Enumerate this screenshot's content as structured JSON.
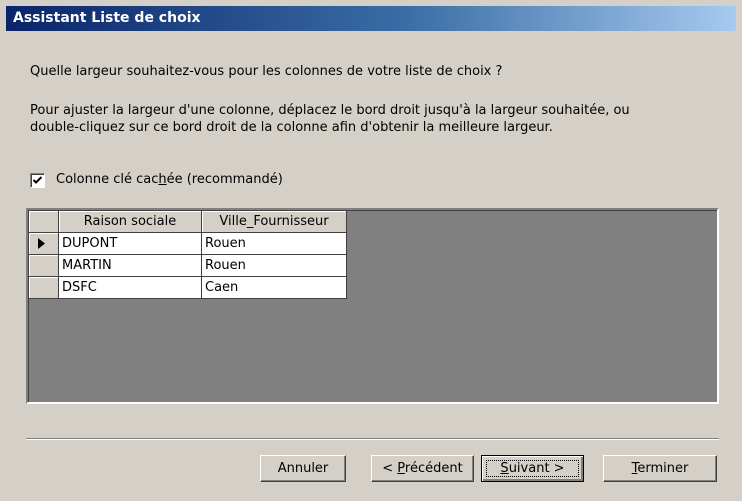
{
  "window": {
    "title": "Assistant Liste de choix"
  },
  "question": "Quelle largeur souhaitez-vous pour les colonnes de votre liste de choix ?",
  "instructions": {
    "line1": "Pour ajuster la largeur d'une colonne, déplacez le bord droit jusqu'à la largeur souhaitée, ou",
    "line2": "double-cliquez sur ce bord droit de la colonne afin d'obtenir la meilleure largeur."
  },
  "hide_key": {
    "checked": true,
    "label_before": "Colonne clé cac",
    "label_mnemonic": "h",
    "label_after": "ée (recommandé)"
  },
  "grid": {
    "columns": [
      "Raison sociale",
      "Ville_Fournisseur"
    ],
    "rows": [
      [
        "DUPONT",
        "Rouen"
      ],
      [
        "MARTIN",
        "Rouen"
      ],
      [
        "DSFC",
        "Caen"
      ]
    ],
    "current_row": 1
  },
  "buttons": {
    "cancel": "Annuler",
    "previous_before": "< ",
    "previous_mnemonic": "P",
    "previous_after": "récédent",
    "next_mnemonic": "S",
    "next_after": "uivant >",
    "finish_mnemonic": "T",
    "finish_after": "erminer"
  }
}
